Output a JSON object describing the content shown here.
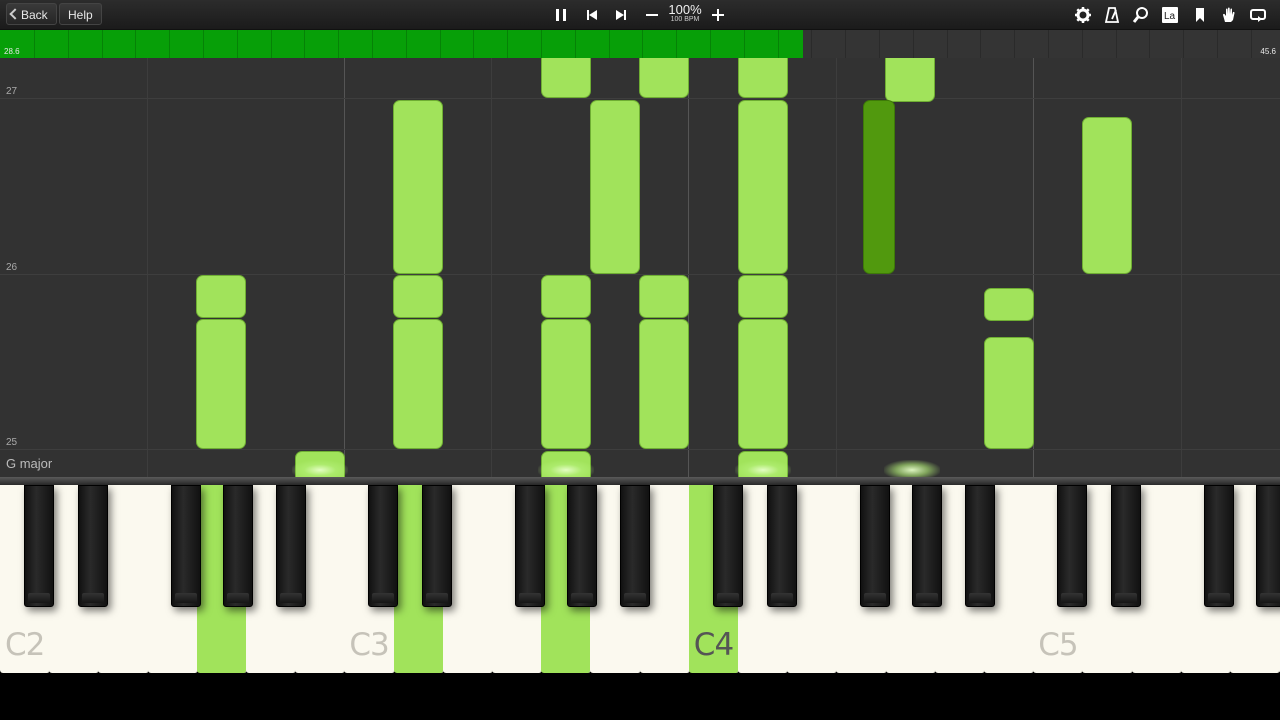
{
  "toolbar": {
    "back_label": "Back",
    "help_label": "Help",
    "speed": "100%",
    "bpm": "100 BPM",
    "icons": [
      "pause-icon",
      "skip-back-icon",
      "skip-forward-icon",
      "minus-icon",
      "plus-icon",
      "gear-icon",
      "metronome-icon",
      "magnifier-icon",
      "note-label-icon",
      "bookmark-icon",
      "hand-icon",
      "loop-icon"
    ]
  },
  "progress": {
    "start_label": "28.6",
    "end_label": "45.6",
    "fraction": 0.627,
    "color": "#079f08"
  },
  "roll": {
    "measures": [
      "27",
      "26",
      "25"
    ],
    "key_signature": "G major",
    "note_color": "#a1e35b",
    "note_dark_color": "#51990e"
  },
  "keyboard": {
    "octave_labels": [
      "C2",
      "C3",
      "C4",
      "C5"
    ],
    "lit_keys": [
      "G2",
      "D3",
      "G3",
      "C4"
    ]
  }
}
